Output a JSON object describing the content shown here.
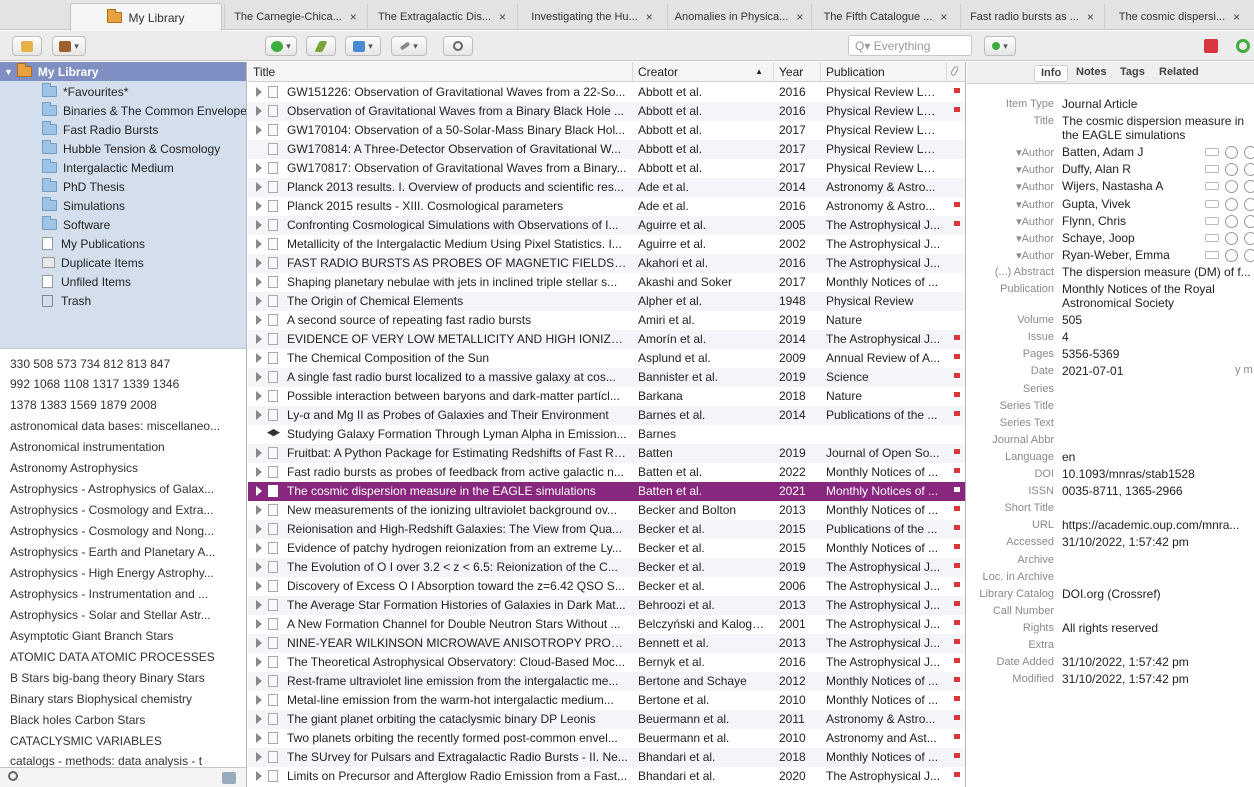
{
  "tabs": [
    {
      "label": "My Library"
    },
    {
      "label": "The Carnegie-Chica..."
    },
    {
      "label": "The Extragalactic Dis..."
    },
    {
      "label": "Investigating the Hu..."
    },
    {
      "label": "Anomalies in Physica..."
    },
    {
      "label": "The Fifth Catalogue ..."
    },
    {
      "label": "Fast radio bursts as ..."
    },
    {
      "label": "The cosmic dispersi..."
    }
  ],
  "tab_close": "×",
  "search": {
    "placeholder": "Everything",
    "prefix": "Q▾"
  },
  "collections": [
    {
      "label": "My Library"
    },
    {
      "label": "*Favourites*"
    },
    {
      "label": "Binaries & The Common Envelope"
    },
    {
      "label": "Fast Radio Bursts"
    },
    {
      "label": "Hubble Tension & Cosmology"
    },
    {
      "label": "Intergalactic Medium"
    },
    {
      "label": "PhD Thesis"
    },
    {
      "label": "Simulations"
    },
    {
      "label": "Software"
    },
    {
      "label": "My Publications"
    },
    {
      "label": "Duplicate Items"
    },
    {
      "label": "Unfiled Items"
    },
    {
      "label": "Trash"
    }
  ],
  "tags": [
    "330  508  573  734  812  813  847",
    "992  1068  1108  1317  1339  1346",
    "1378  1383  1569  1879  2008",
    "astronomical data bases: miscellaneo...",
    "Astronomical instrumentation",
    "Astronomy  Astrophysics",
    "Astrophysics - Astrophysics of Galax...",
    "Astrophysics - Cosmology and Extra...",
    "Astrophysics - Cosmology and Nong...",
    "Astrophysics - Earth and Planetary A...",
    "Astrophysics - High Energy Astrophy...",
    "Astrophysics - Instrumentation and ...",
    "Astrophysics - Solar and Stellar Astr...",
    "Asymptotic Giant Branch Stars",
    "ATOMIC DATA  ATOMIC PROCESSES",
    "B Stars  big-bang theory  Binary Stars",
    "Binary stars  Biophysical chemistry",
    "Black holes  Carbon Stars",
    "CATACLYSMIC VARIABLES",
    "catalogs - methods: data analysis - t"
  ],
  "columns": {
    "title": "Title",
    "creator": "Creator",
    "year": "Year",
    "publication": "Publication"
  },
  "rows": [
    {
      "title": "GW151226: Observation of Gravitational Waves from a 22-So...",
      "creator": "Abbott et al.",
      "year": "2016",
      "pub": "Physical Review Let...",
      "flag": true,
      "tw": true
    },
    {
      "title": "Observation of Gravitational Waves from a Binary Black Hole ...",
      "creator": "Abbott et al.",
      "year": "2016",
      "pub": "Physical Review Let...",
      "flag": true,
      "tw": true
    },
    {
      "title": "GW170104: Observation of a 50-Solar-Mass Binary Black Hol...",
      "creator": "Abbott et al.",
      "year": "2017",
      "pub": "Physical Review Let...",
      "flag": false,
      "tw": true
    },
    {
      "title": "GW170814: A Three-Detector Observation of Gravitational W...",
      "creator": "Abbott et al.",
      "year": "2017",
      "pub": "Physical Review Let...",
      "flag": false,
      "tw": false
    },
    {
      "title": "GW170817: Observation of Gravitational Waves from a Binary...",
      "creator": "Abbott et al.",
      "year": "2017",
      "pub": "Physical Review Let...",
      "flag": false,
      "tw": true
    },
    {
      "title": "Planck 2013 results. I. Overview of products and scientific res...",
      "creator": "Ade et al.",
      "year": "2014",
      "pub": "Astronomy & Astro...",
      "flag": false,
      "tw": true
    },
    {
      "title": "Planck 2015 results - XIII. Cosmological parameters",
      "creator": "Ade et al.",
      "year": "2016",
      "pub": "Astronomy & Astro...",
      "flag": true,
      "tw": true
    },
    {
      "title": "Confronting Cosmological Simulations with Observations of I...",
      "creator": "Aguirre et al.",
      "year": "2005",
      "pub": "The Astrophysical J...",
      "flag": true,
      "tw": true
    },
    {
      "title": "Metallicity of the Intergalactic Medium Using Pixel Statistics. I...",
      "creator": "Aguirre et al.",
      "year": "2002",
      "pub": "The Astrophysical J...",
      "flag": false,
      "tw": true
    },
    {
      "title": "FAST RADIO BURSTS AS PROBES OF MAGNETIC FIELDS IN THE I...",
      "creator": "Akahori et al.",
      "year": "2016",
      "pub": "The Astrophysical J...",
      "flag": false,
      "tw": true
    },
    {
      "title": "Shaping planetary nebulae with jets in inclined triple stellar s...",
      "creator": "Akashi and Soker",
      "year": "2017",
      "pub": "Monthly Notices of ...",
      "flag": false,
      "tw": true
    },
    {
      "title": "The Origin of Chemical Elements",
      "creator": "Alpher et al.",
      "year": "1948",
      "pub": "Physical Review",
      "flag": false,
      "tw": true
    },
    {
      "title": "A second source of repeating fast radio bursts",
      "creator": "Amiri et al.",
      "year": "2019",
      "pub": "Nature",
      "flag": false,
      "tw": true
    },
    {
      "title": "EVIDENCE OF VERY LOW METALLICITY AND HIGH IONIZATION ...",
      "creator": "Amorín et al.",
      "year": "2014",
      "pub": "The Astrophysical J...",
      "flag": true,
      "tw": true
    },
    {
      "title": "The Chemical Composition of the Sun",
      "creator": "Asplund et al.",
      "year": "2009",
      "pub": "Annual Review of A...",
      "flag": true,
      "tw": true
    },
    {
      "title": "A single fast radio burst localized to a massive galaxy at cos...",
      "creator": "Bannister et al.",
      "year": "2019",
      "pub": "Science",
      "flag": true,
      "tw": true
    },
    {
      "title": "Possible interaction between baryons and dark-matter partícl...",
      "creator": "Barkana",
      "year": "2018",
      "pub": "Nature",
      "flag": true,
      "tw": true
    },
    {
      "title": "Ly-α and Mg II as Probes of Galaxies and Their Environment",
      "creator": "Barnes et al.",
      "year": "2014",
      "pub": "Publications of the ...",
      "flag": true,
      "tw": true
    },
    {
      "title": "Studying Galaxy Formation Through Lyman Alpha in Emission...",
      "creator": "Barnes",
      "year": "",
      "pub": "",
      "flag": false,
      "tw": false,
      "cap": true
    },
    {
      "title": "Fruitbat: A Python Package for Estimating Redshifts of Fast Ra...",
      "creator": "Batten",
      "year": "2019",
      "pub": "Journal of Open So...",
      "flag": true,
      "tw": true
    },
    {
      "title": "Fast radio bursts as probes of feedback from active galactic n...",
      "creator": "Batten et al.",
      "year": "2022",
      "pub": "Monthly Notices of ...",
      "flag": true,
      "tw": true
    },
    {
      "title": "The cosmic dispersion measure in the EAGLE simulations",
      "creator": "Batten et al.",
      "year": "2021",
      "pub": "Monthly Notices of ...",
      "flag": true,
      "tw": true,
      "sel": true
    },
    {
      "title": "New measurements of the ionizing ultraviolet background ov...",
      "creator": "Becker and Bolton",
      "year": "2013",
      "pub": "Monthly Notices of ...",
      "flag": true,
      "tw": true
    },
    {
      "title": "Reionisation and High-Redshift Galaxies: The View from Qua...",
      "creator": "Becker et al.",
      "year": "2015",
      "pub": "Publications of the ...",
      "flag": true,
      "tw": true
    },
    {
      "title": "Evidence of patchy hydrogen reionization from an extreme Ly...",
      "creator": "Becker et al.",
      "year": "2015",
      "pub": "Monthly Notices of ...",
      "flag": true,
      "tw": true
    },
    {
      "title": "The Evolution of O I over 3.2 < z < 6.5: Reionization of the C...",
      "creator": "Becker et al.",
      "year": "2019",
      "pub": "The Astrophysical J...",
      "flag": true,
      "tw": true
    },
    {
      "title": "Discovery of Excess O I Absorption toward the z=6.42 QSO S...",
      "creator": "Becker et al.",
      "year": "2006",
      "pub": "The Astrophysical J...",
      "flag": true,
      "tw": true
    },
    {
      "title": "The Average Star Formation Histories of Galaxies in Dark Mat...",
      "creator": "Behroozi et al.",
      "year": "2013",
      "pub": "The Astrophysical J...",
      "flag": true,
      "tw": true
    },
    {
      "title": "A New Formation Channel for Double Neutron Stars Without ...",
      "creator": "Belczyński and Kalogera",
      "year": "2001",
      "pub": "The Astrophysical J...",
      "flag": true,
      "tw": true
    },
    {
      "title": "NINE-YEAR WILKINSON MICROWAVE ANISOTROPY PROBE ( W...",
      "creator": "Bennett et al.",
      "year": "2013",
      "pub": "The Astrophysical J...",
      "flag": true,
      "tw": true
    },
    {
      "title": "The Theoretical Astrophysical Observatory: Cloud-Based Moc...",
      "creator": "Bernyk et al.",
      "year": "2016",
      "pub": "The Astrophysical J...",
      "flag": true,
      "tw": true
    },
    {
      "title": "Rest-frame ultraviolet line emission from the intergalactic me...",
      "creator": "Bertone and Schaye",
      "year": "2012",
      "pub": "Monthly Notices of ...",
      "flag": true,
      "tw": true
    },
    {
      "title": "Metal-line emission from the warm-hot intergalactic medium...",
      "creator": "Bertone et al.",
      "year": "2010",
      "pub": "Monthly Notices of ...",
      "flag": true,
      "tw": true
    },
    {
      "title": "The giant planet orbiting the cataclysmic binary DP Leonis",
      "creator": "Beuermann et al.",
      "year": "2011",
      "pub": "Astronomy & Astro...",
      "flag": true,
      "tw": true
    },
    {
      "title": "Two planets orbiting the recently formed post-common envel...",
      "creator": "Beuermann et al.",
      "year": "2010",
      "pub": "Astronomy and Ast...",
      "flag": true,
      "tw": true
    },
    {
      "title": "The SUrvey for Pulsars and Extragalactic Radio Bursts - II. Ne...",
      "creator": "Bhandari et al.",
      "year": "2018",
      "pub": "Monthly Notices of ...",
      "flag": true,
      "tw": true
    },
    {
      "title": "Limits on Precursor and Afterglow Radio Emission from a Fast...",
      "creator": "Bhandari et al.",
      "year": "2020",
      "pub": "The Astrophysical J...",
      "flag": true,
      "tw": true
    }
  ],
  "pane_tabs": [
    "Info",
    "Notes",
    "Tags",
    "Related"
  ],
  "info": [
    {
      "label": "Item Type",
      "value": "Journal Article"
    },
    {
      "label": "Title",
      "value": "The cosmic dispersion measure in",
      "value2": "the EAGLE simulations"
    },
    {
      "label": "▾Author",
      "value": "Batten, Adam J"
    },
    {
      "label": "▾Author",
      "value": "Duffy, Alan R"
    },
    {
      "label": "▾Author",
      "value": "Wijers, Nastasha A"
    },
    {
      "label": "▾Author",
      "value": "Gupta, Vivek"
    },
    {
      "label": "▾Author",
      "value": "Flynn, Chris"
    },
    {
      "label": "▾Author",
      "value": "Schaye, Joop"
    },
    {
      "label": "▾Author",
      "value": "Ryan-Weber, Emma"
    },
    {
      "label": "(...) Abstract",
      "value": "The dispersion measure (DM) of f..."
    },
    {
      "label": "Publication",
      "value": "Monthly Notices of the Royal",
      "value2": "Astronomical Society"
    },
    {
      "label": "Volume",
      "value": "505"
    },
    {
      "label": "Issue",
      "value": "4"
    },
    {
      "label": "Pages",
      "value": "5356-5369"
    },
    {
      "label": "Date",
      "value": "2021-07-01",
      "extra": "y m d"
    },
    {
      "label": "Series",
      "value": ""
    },
    {
      "label": "Series Title",
      "value": ""
    },
    {
      "label": "Series Text",
      "value": ""
    },
    {
      "label": "Journal Abbr",
      "value": ""
    },
    {
      "label": "Language",
      "value": "en"
    },
    {
      "label": "DOI",
      "value": "10.1093/mnras/stab1528"
    },
    {
      "label": "ISSN",
      "value": "0035-8711, 1365-2966"
    },
    {
      "label": "Short Title",
      "value": ""
    },
    {
      "label": "URL",
      "value": "https://academic.oup.com/mnra..."
    },
    {
      "label": "Accessed",
      "value": "31/10/2022, 1:57:42 pm"
    },
    {
      "label": "Archive",
      "value": ""
    },
    {
      "label": "Loc. in Archive",
      "value": ""
    },
    {
      "label": "Library Catalog",
      "value": "DOI.org (Crossref)"
    },
    {
      "label": "Call Number",
      "value": ""
    },
    {
      "label": "Rights",
      "value": "All rights reserved"
    },
    {
      "label": "Extra",
      "value": ""
    },
    {
      "label": "Date Added",
      "value": "31/10/2022, 1:57:42 pm"
    },
    {
      "label": "Modified",
      "value": "31/10/2022, 1:57:42 pm"
    }
  ],
  "colors": {
    "selected_row": "#88277e",
    "sidebar_bg": "#d4dfee",
    "sidebar_selected": "#7f8fc4",
    "flag": "#d9363e"
  }
}
